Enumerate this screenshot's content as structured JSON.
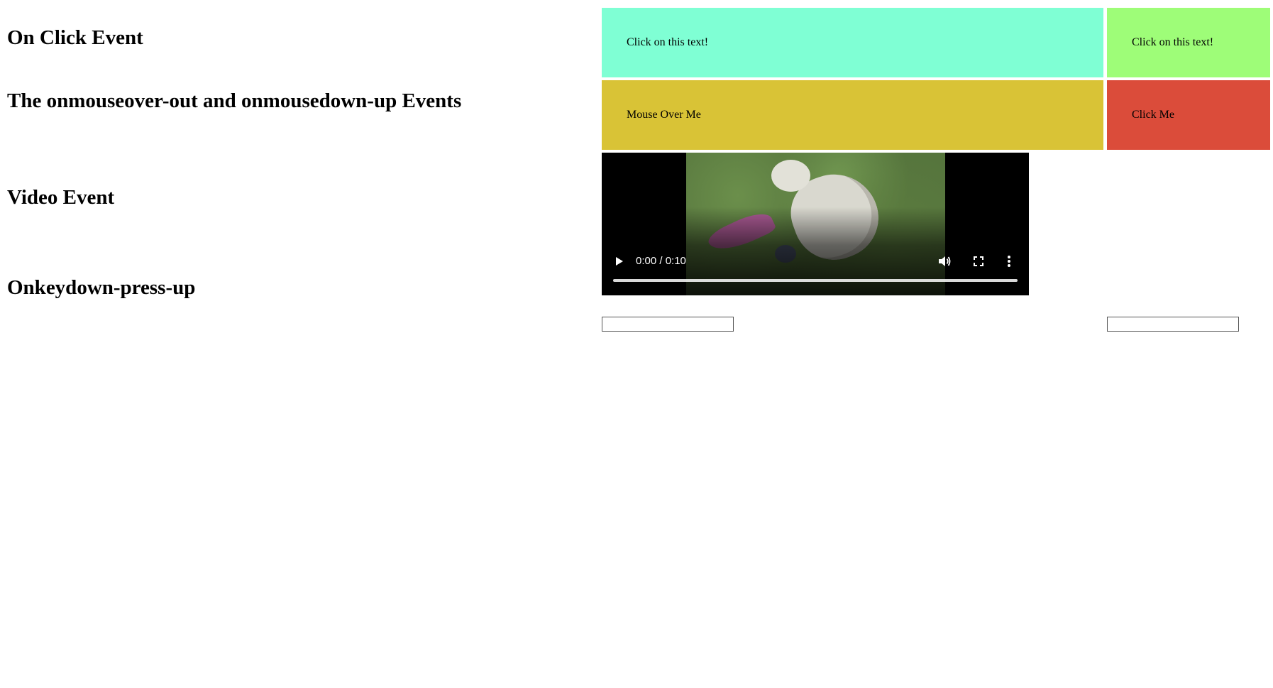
{
  "sections": {
    "onclick": "On Click Event",
    "mouse": "The onmouseover-out and onmousedown-up Events",
    "video": "Video Event",
    "keys": "Onkeydown-press-up"
  },
  "boxes": {
    "click1": {
      "label": "Click on this text!",
      "color": "#7fffd4"
    },
    "click2": {
      "label": "Click on this text!",
      "color": "#9efd78"
    },
    "hover": {
      "label": "Mouse Over Me",
      "color": "#d9c336"
    },
    "down": {
      "label": "Click Me",
      "color": "#db4c3a"
    }
  },
  "video": {
    "time": "0:00 / 0:10",
    "progress": 0,
    "icons": [
      "play-icon",
      "volume-icon",
      "fullscreen-icon",
      "more-options-icon"
    ]
  },
  "inputs": [
    {
      "value": "",
      "placeholder": ""
    },
    {
      "value": "",
      "placeholder": ""
    }
  ]
}
